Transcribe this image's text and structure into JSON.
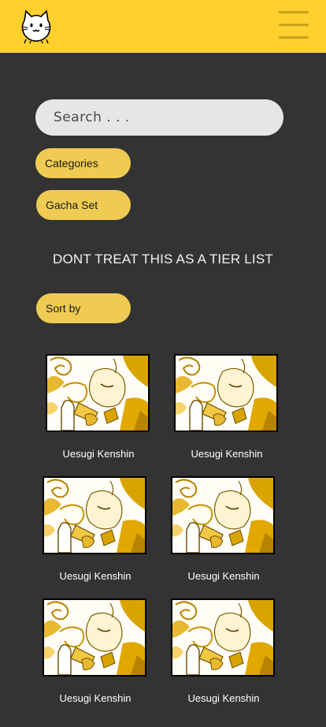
{
  "header": {
    "logo_icon": "cat-face-icon",
    "menu_icon": "hamburger-menu-icon",
    "bar_color": "#FFD02E"
  },
  "search": {
    "placeholder": "Search . . ."
  },
  "filters": {
    "categories_label": "Categories",
    "gacha_set_label": "Gacha Set",
    "sort_label": "Sort by"
  },
  "notice": "DONT TREAT THIS AS A TIER LIST",
  "units": [
    {
      "name": "Uesugi Kenshin"
    },
    {
      "name": "Uesugi Kenshin"
    },
    {
      "name": "Uesugi Kenshin"
    },
    {
      "name": "Uesugi Kenshin"
    },
    {
      "name": "Uesugi Kenshin"
    },
    {
      "name": "Uesugi Kenshin"
    }
  ],
  "colors": {
    "background": "#333333",
    "pill": "#F0CB54",
    "search_bg": "#E6E6E6",
    "art_gold": "#D9A300"
  }
}
